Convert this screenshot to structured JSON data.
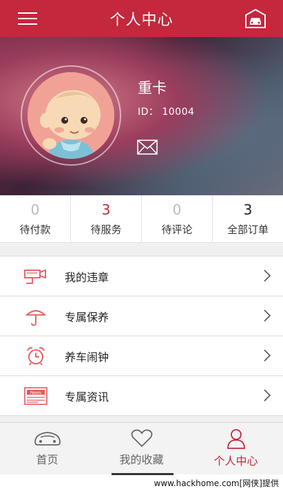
{
  "header": {
    "title": "个人中心"
  },
  "profile": {
    "name": "重卡",
    "id_text": "ID： 10004"
  },
  "counts": [
    {
      "value": "0",
      "label": "待付款"
    },
    {
      "value": "3",
      "label": "待服务"
    },
    {
      "value": "0",
      "label": "待评论"
    },
    {
      "value": "3",
      "label": "全部订单"
    }
  ],
  "menu": [
    {
      "label": "我的违章",
      "icon": "camera-icon"
    },
    {
      "label": "专属保养",
      "icon": "umbrella-icon"
    },
    {
      "label": "养车闹钟",
      "icon": "alarm-clock-icon"
    },
    {
      "label": "专属资讯",
      "icon": "newspaper-icon"
    }
  ],
  "tabs": [
    {
      "label": "首页",
      "icon": "car-icon"
    },
    {
      "label": "我的收藏",
      "icon": "heart-icon"
    },
    {
      "label": "个人中心",
      "icon": "person-icon"
    }
  ],
  "icon_news_text": "News",
  "watermark": "www.hackhome.com[网侠]提供",
  "colors": {
    "accent": "#c3283d",
    "header_bg": "#c3283d"
  }
}
